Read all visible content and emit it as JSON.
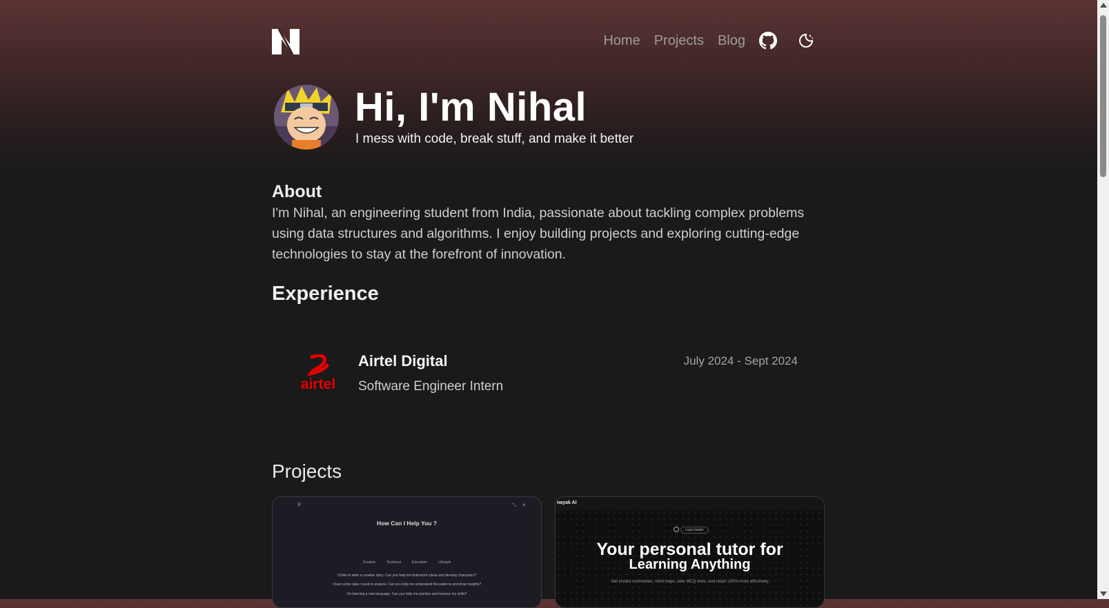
{
  "nav": {
    "links": [
      "Home",
      "Projects",
      "Blog"
    ],
    "github_icon": "github-icon",
    "theme_icon": "moon-sparkle-icon",
    "logo_icon": "n-logo-icon"
  },
  "hero": {
    "title": "Hi, I'm Nihal",
    "subtitle": "I mess with code, break stuff, and make it better",
    "avatar_icon": "anime-avatar"
  },
  "about": {
    "heading": "About",
    "text": "I'm Nihal, an engineering student from India, passionate about tackling complex problems using data structures and algorithms. I enjoy building projects and exploring cutting-edge technologies to stay at the forefront of innovation."
  },
  "experience": {
    "heading": "Experience",
    "items": [
      {
        "company": "Airtel Digital",
        "role": "Software Engineer Intern",
        "date": "July 2024 - Sept 2024",
        "logo_text": "airtel"
      }
    ]
  },
  "projects": {
    "heading": "Projects",
    "card1": {
      "title": "How Can I Help You ?",
      "tabs": [
        "Creative",
        "Technical",
        "Education",
        "Lifestyle"
      ],
      "lines": [
        "I'd like to write a creative story. Can you help me brainstorm ideas and develop characters?",
        "I have some data I need to analyze. Can you help me understand the patterns and draw insights?",
        "I'm learning a new language. Can you help me practice and improve my skills?"
      ]
    },
    "card2": {
      "brand": "nayak AI",
      "badge": "Learn faster",
      "title_line1": "Your personal tutor for",
      "title_line2": "Learning Anything",
      "description": "Get instant summaries, mind maps, take MCQ tests, and retain 100% more effectively."
    }
  },
  "colors": {
    "background_top": "#5c3435",
    "background": "#1a1a1a",
    "airtel_red": "#e40000",
    "nav_link": "#9d9d9d"
  }
}
